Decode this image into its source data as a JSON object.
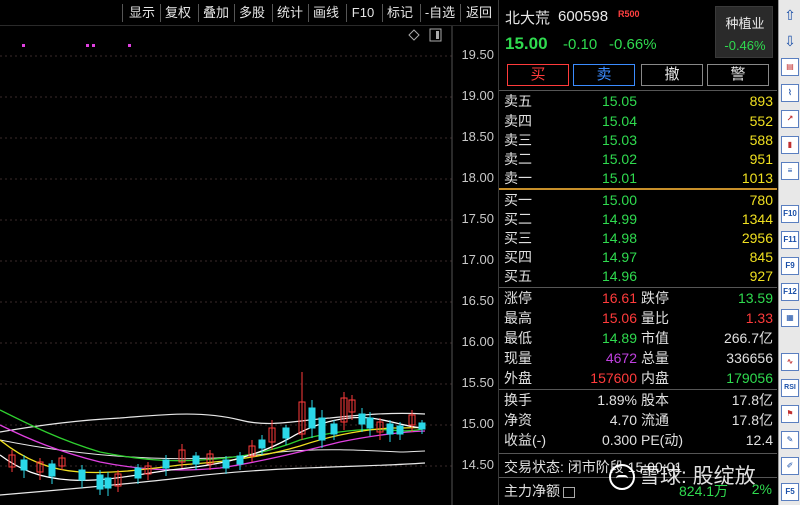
{
  "toolbar": {
    "items": [
      "显示",
      "复权",
      "叠加",
      "多股",
      "统计",
      "画线",
      "F10",
      "标记",
      "-自选",
      "返回"
    ]
  },
  "chart": {
    "y_labels": [
      "19.50",
      "19.00",
      "18.50",
      "18.00",
      "17.50",
      "17.00",
      "16.50",
      "16.00",
      "15.50",
      "15.00",
      "14.50"
    ]
  },
  "header": {
    "name": "北大荒",
    "code": "600598",
    "badge": "R500",
    "price": "15.00",
    "change": "-0.10",
    "change_pct": "-0.66%",
    "sector_name": "种植业",
    "sector_pct": "-0.46%"
  },
  "actions": {
    "buy": "买",
    "sell": "卖",
    "cancel": "撤",
    "alert": "警"
  },
  "asks": [
    {
      "label": "卖五",
      "price": "15.05",
      "vol": "893"
    },
    {
      "label": "卖四",
      "price": "15.04",
      "vol": "552"
    },
    {
      "label": "卖三",
      "price": "15.03",
      "vol": "588"
    },
    {
      "label": "卖二",
      "price": "15.02",
      "vol": "951"
    },
    {
      "label": "卖一",
      "price": "15.01",
      "vol": "1013"
    }
  ],
  "bids": [
    {
      "label": "买一",
      "price": "15.00",
      "vol": "780"
    },
    {
      "label": "买二",
      "price": "14.99",
      "vol": "1344"
    },
    {
      "label": "买三",
      "price": "14.98",
      "vol": "2956"
    },
    {
      "label": "买四",
      "price": "14.97",
      "vol": "845"
    },
    {
      "label": "买五",
      "price": "14.96",
      "vol": "927"
    }
  ],
  "stats1": [
    {
      "l1": "涨停",
      "v1": "16.61",
      "c1": "#ff3b3b",
      "l2": "跌停",
      "v2": "13.59",
      "c2": "#2fdb4f"
    },
    {
      "l1": "最高",
      "v1": "15.06",
      "c1": "#ff3b3b",
      "l2": "量比",
      "v2": "1.33",
      "c2": "#ff3b3b"
    },
    {
      "l1": "最低",
      "v1": "14.89",
      "c1": "#2fdb4f",
      "l2": "市值",
      "v2": "266.7亿",
      "c2": "#e0e0e0"
    },
    {
      "l1": "现量",
      "v1": "4672",
      "c1": "#c040e0",
      "l2": "总量",
      "v2": "336656",
      "c2": "#e0e0e0"
    },
    {
      "l1": "外盘",
      "v1": "157600",
      "c1": "#ff3b3b",
      "l2": "内盘",
      "v2": "179056",
      "c2": "#2fdb4f"
    }
  ],
  "stats2": [
    {
      "l1": "换手",
      "v1": "1.89%",
      "l2": "股本",
      "v2": "17.8亿"
    },
    {
      "l1": "净资",
      "v1": "4.70",
      "l2": "流通",
      "v2": "17.8亿"
    },
    {
      "l1": "收益(-)",
      "v1": "0.300",
      "l2": "PE(动)",
      "v2": "12.4"
    }
  ],
  "footer": {
    "trade_state": "交易状态: 闭市阶段 15:00:01",
    "net_label": "主力净额",
    "net_value": "824.1万",
    "net_pct": "2%"
  },
  "watermark": "雪球: 股绽放",
  "sidebar": {
    "items": [
      "up-arrow-icon",
      "down-arrow-icon",
      "report-icon",
      "minute-chart-icon",
      "trend-icon",
      "kline-icon",
      "list-icon",
      "F10",
      "F11",
      "F9",
      "F12",
      "table-icon",
      "wave-icon",
      "RSI",
      "bookmark-icon",
      "edit-icon",
      "F5"
    ]
  }
}
